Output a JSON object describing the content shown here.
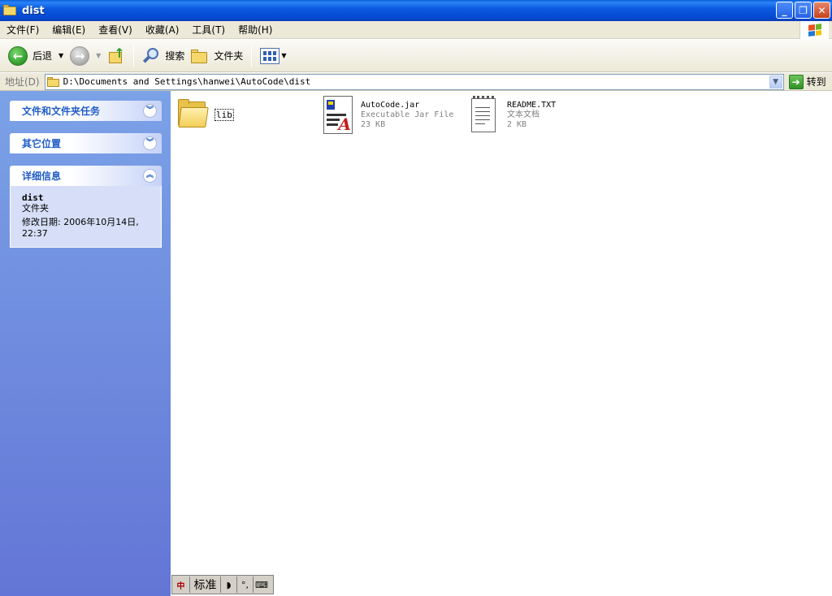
{
  "window": {
    "title": "dist"
  },
  "menu": [
    "文件(F)",
    "编辑(E)",
    "查看(V)",
    "收藏(A)",
    "工具(T)",
    "帮助(H)"
  ],
  "toolbar": {
    "back_label": "后退",
    "search_label": "搜索",
    "folders_label": "文件夹"
  },
  "address": {
    "label": "地址(D)",
    "path": "D:\\Documents and Settings\\hanwei\\AutoCode\\dist",
    "go_label": "转到"
  },
  "taskpane": {
    "tasks_title": "文件和文件夹任务",
    "other_title": "其它位置",
    "details_title": "详细信息",
    "details": {
      "name": "dist",
      "type": "文件夹",
      "modified_line1": "修改日期: 2006年10月14日,",
      "modified_line2": "22:37"
    }
  },
  "files": [
    {
      "name": "lib",
      "icon": "folder-icon"
    },
    {
      "name": "AutoCode.jar",
      "type": "Executable Jar File",
      "size": "23 KB",
      "icon": "jar-file-icon"
    },
    {
      "name": "README.TXT",
      "type": "文本文档",
      "size": "2 KB",
      "icon": "text-file-icon"
    }
  ],
  "ime": {
    "mode": "标准"
  },
  "colors": {
    "titlebar": "#0b5ae0",
    "taskpane_top": "#7ba2e7",
    "taskpane_bottom": "#6375d6",
    "panel_title": "#215dc6"
  }
}
